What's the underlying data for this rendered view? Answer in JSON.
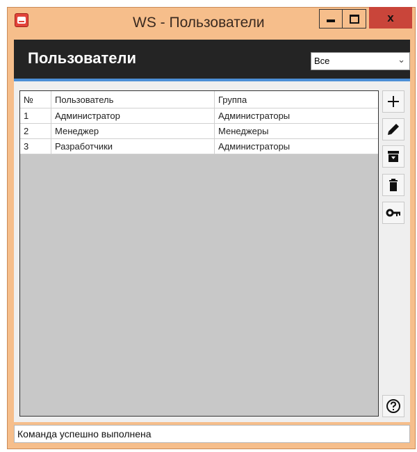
{
  "window": {
    "title": "WS - Пользователи",
    "close_label": "x"
  },
  "header": {
    "title": "Пользователи",
    "filter": {
      "selected": "Все"
    }
  },
  "table": {
    "columns": [
      "№",
      "Пользователь",
      "Группа"
    ],
    "rows": [
      [
        "1",
        "Администратор",
        "Администраторы"
      ],
      [
        "2",
        "Менеджер",
        "Менеджеры"
      ],
      [
        "3",
        "Разработчики",
        "Администраторы"
      ]
    ]
  },
  "toolbar": {
    "icons": [
      "plus-icon",
      "pencil-icon",
      "archive-icon",
      "trash-icon",
      "key-icon",
      "help-icon"
    ]
  },
  "status": {
    "text": "Команда успешно выполнена"
  },
  "colors": {
    "titlebar": "#f6be8b",
    "header": "#242424",
    "accent": "#4c8fd6",
    "close": "#c9453a"
  }
}
